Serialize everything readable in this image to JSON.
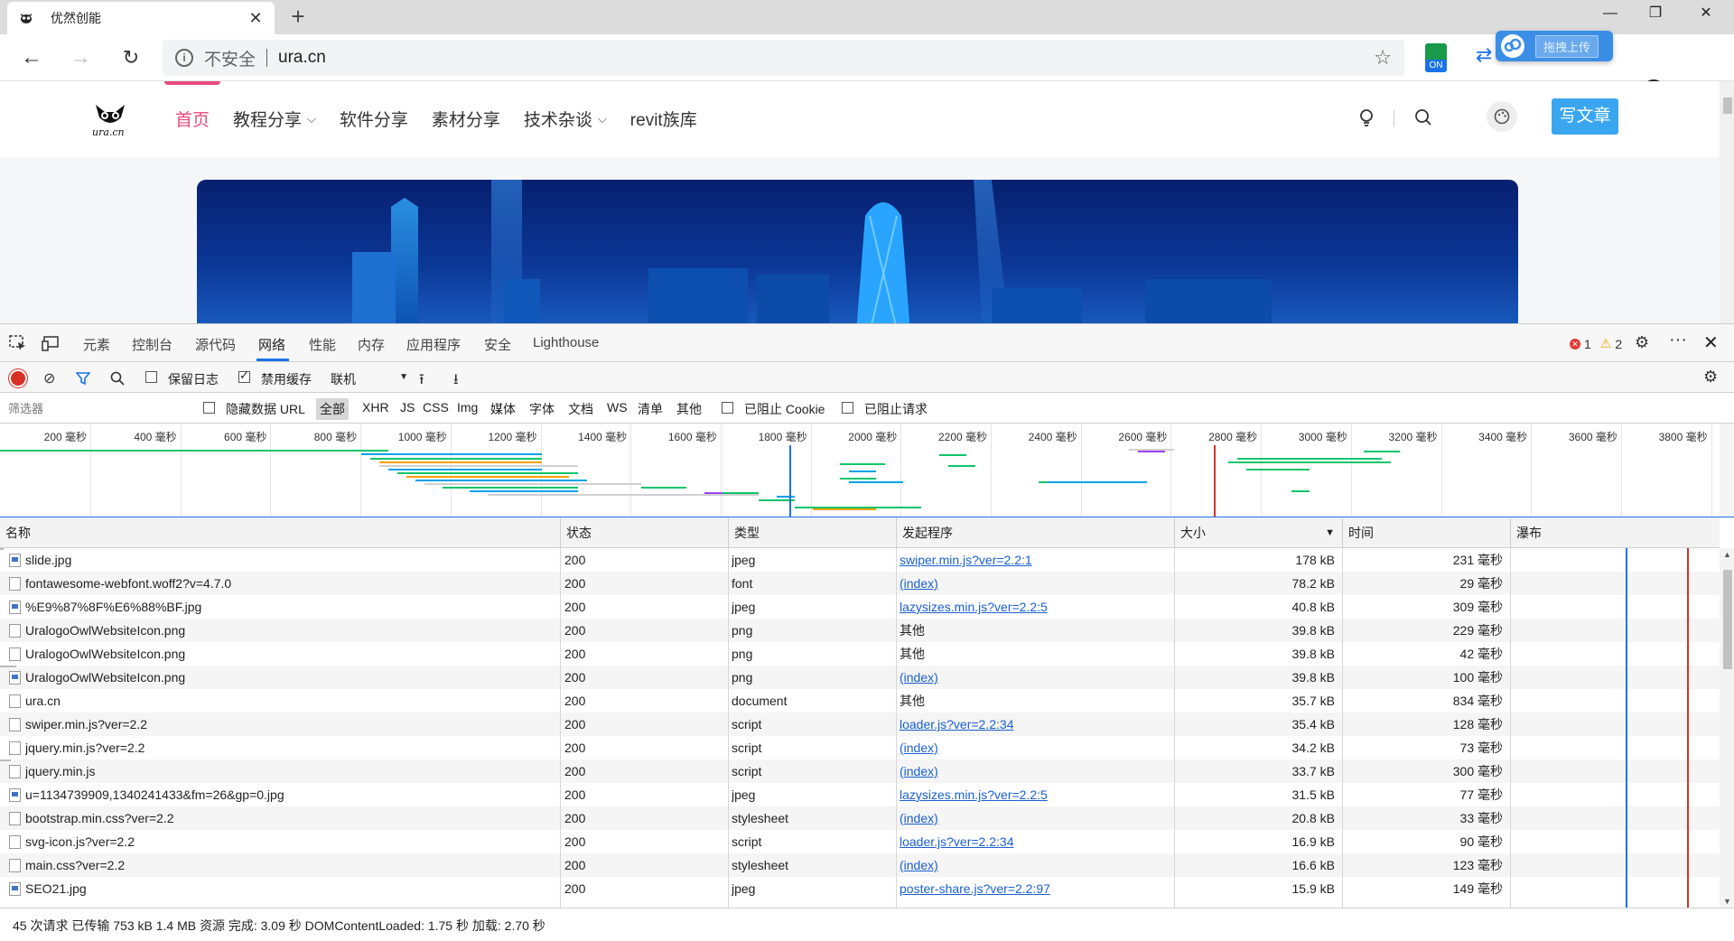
{
  "browser": {
    "tab_title": "优然创能",
    "address_insecure": "不安全",
    "address_url": "ura.cn",
    "ext_on_label": "ON",
    "upload_label": "拖拽上传"
  },
  "site": {
    "logo_text": "ura.cn",
    "nav": [
      {
        "label": "首页",
        "active": true
      },
      {
        "label": "教程分享",
        "dropdown": true
      },
      {
        "label": "软件分享"
      },
      {
        "label": "素材分享"
      },
      {
        "label": "技术杂谈",
        "dropdown": true
      },
      {
        "label": "revit族库"
      }
    ],
    "write_button": "写文章"
  },
  "devtools": {
    "tabs": [
      "元素",
      "控制台",
      "源代码",
      "网络",
      "性能",
      "内存",
      "应用程序",
      "安全",
      "Lighthouse"
    ],
    "selected_tab": "网络",
    "errors": "1",
    "warnings": "2",
    "toolbar": {
      "preserve_log": "保留日志",
      "disable_cache": "禁用缓存",
      "throttle": "联机"
    },
    "filter": {
      "placeholder": "筛选器",
      "hide_data_url": "隐藏数据 URL",
      "types": [
        "全部",
        "XHR",
        "JS",
        "CSS",
        "Img",
        "媒体",
        "字体",
        "文档",
        "WS",
        "清单",
        "其他"
      ],
      "blocked_cookies": "已阻止 Cookie",
      "blocked_requests": "已阻止请求"
    },
    "overview_ticks": [
      "200 毫秒",
      "400 毫秒",
      "600 毫秒",
      "800 毫秒",
      "1000 毫秒",
      "1200 毫秒",
      "1400 毫秒",
      "1600 毫秒",
      "1800 毫秒",
      "2000 毫秒",
      "2200 毫秒",
      "2400 毫秒",
      "2600 毫秒",
      "2800 毫秒",
      "3000 毫秒",
      "3200 毫秒",
      "3400 毫秒",
      "3600 毫秒",
      "3800 毫秒"
    ],
    "columns": {
      "name": "名称",
      "status": "状态",
      "type": "类型",
      "initiator": "发起程序",
      "size": "大小",
      "time": "时间",
      "waterfall": "瀑布"
    },
    "rows": [
      {
        "name": "slide.jpg",
        "status": "200",
        "type": "jpeg",
        "initiator": "swiper.min.js?ver=2.2:1",
        "link": true,
        "size": "178 kB",
        "time": "231 毫秒",
        "img": true
      },
      {
        "name": "fontawesome-webfont.woff2?v=4.7.0",
        "status": "200",
        "type": "font",
        "initiator": "(index)",
        "link": true,
        "size": "78.2 kB",
        "time": "29 毫秒"
      },
      {
        "name": "%E9%87%8F%E6%88%BF.jpg",
        "status": "200",
        "type": "jpeg",
        "initiator": "lazysizes.min.js?ver=2.2:5",
        "link": true,
        "size": "40.8 kB",
        "time": "309 毫秒",
        "img": true
      },
      {
        "name": "UralogoOwlWebsiteIcon.png",
        "status": "200",
        "type": "png",
        "initiator": "其他",
        "link": false,
        "size": "39.8 kB",
        "time": "229 毫秒"
      },
      {
        "name": "UralogoOwlWebsiteIcon.png",
        "status": "200",
        "type": "png",
        "initiator": "其他",
        "link": false,
        "size": "39.8 kB",
        "time": "42 毫秒"
      },
      {
        "name": "UralogoOwlWebsiteIcon.png",
        "status": "200",
        "type": "png",
        "initiator": "(index)",
        "link": true,
        "size": "39.8 kB",
        "time": "100 毫秒",
        "img": true
      },
      {
        "name": "ura.cn",
        "status": "200",
        "type": "document",
        "initiator": "其他",
        "link": false,
        "size": "35.7 kB",
        "time": "834 毫秒"
      },
      {
        "name": "swiper.min.js?ver=2.2",
        "status": "200",
        "type": "script",
        "initiator": "loader.js?ver=2.2:34",
        "link": true,
        "size": "35.4 kB",
        "time": "128 毫秒"
      },
      {
        "name": "jquery.min.js?ver=2.2",
        "status": "200",
        "type": "script",
        "initiator": "(index)",
        "link": true,
        "size": "34.2 kB",
        "time": "73 毫秒"
      },
      {
        "name": "jquery.min.js",
        "status": "200",
        "type": "script",
        "initiator": "(index)",
        "link": true,
        "size": "33.7 kB",
        "time": "300 毫秒"
      },
      {
        "name": "u=1134739909,1340241433&fm=26&gp=0.jpg",
        "status": "200",
        "type": "jpeg",
        "initiator": "lazysizes.min.js?ver=2.2:5",
        "link": true,
        "size": "31.5 kB",
        "time": "77 毫秒",
        "img": true
      },
      {
        "name": "bootstrap.min.css?ver=2.2",
        "status": "200",
        "type": "stylesheet",
        "initiator": "(index)",
        "link": true,
        "size": "20.8 kB",
        "time": "33 毫秒"
      },
      {
        "name": "svg-icon.js?ver=2.2",
        "status": "200",
        "type": "script",
        "initiator": "loader.js?ver=2.2:34",
        "link": true,
        "size": "16.9 kB",
        "time": "90 毫秒"
      },
      {
        "name": "main.css?ver=2.2",
        "status": "200",
        "type": "stylesheet",
        "initiator": "(index)",
        "link": true,
        "size": "16.6 kB",
        "time": "123 毫秒"
      },
      {
        "name": "SEO21.jpg",
        "status": "200",
        "type": "jpeg",
        "initiator": "poster-share.js?ver=2.2:97",
        "link": true,
        "size": "15.9 kB",
        "time": "149 毫秒",
        "img": true
      }
    ],
    "summary": "45 次请求  已传输 753 kB  1.4 MB 资源  完成: 3.09 秒  DOMContentLoaded: 1.75 秒  加载: 2.70 秒"
  },
  "colors": {
    "accent_pink": "#e84a7c",
    "write_button": "#3aa6f0",
    "devtools_blue": "#1a73e8",
    "wf_green": "#0ec56a",
    "wf_blue": "#00a2e8",
    "load_red": "#d93025"
  }
}
